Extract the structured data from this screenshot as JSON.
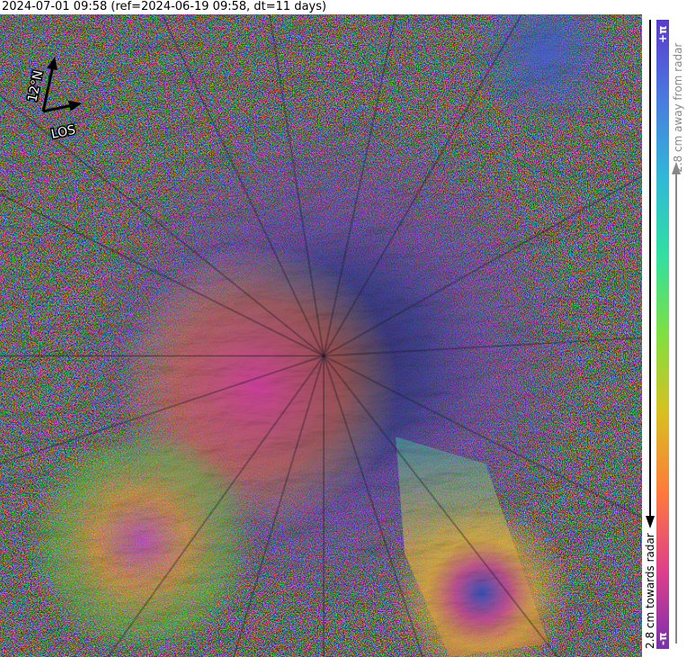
{
  "title": "2024-07-01 09:58 (ref=2024-06-19 09:58, dt=11 days)",
  "compass": {
    "north_label": "12°N",
    "los_label": "LOS"
  },
  "colorbar": {
    "top_symbol": "+π",
    "bottom_symbol": "-π",
    "away_label": "2.8 cm away from radar",
    "towards_label": "2.8 cm towards radar",
    "colors": [
      "#7a2fb0",
      "#e0408a",
      "#ff7a3a",
      "#d8c020",
      "#7fe040",
      "#30e0a0",
      "#30b8d8",
      "#4a7ae0",
      "#5a3ad0"
    ]
  },
  "image": {
    "description_kind": "interferogram-volcano",
    "phase_colors": [
      "#3a2a78",
      "#6a3ab8",
      "#c03aa0",
      "#e86040",
      "#e8c030",
      "#70d040",
      "#30c0a0",
      "#3a70d0"
    ]
  }
}
